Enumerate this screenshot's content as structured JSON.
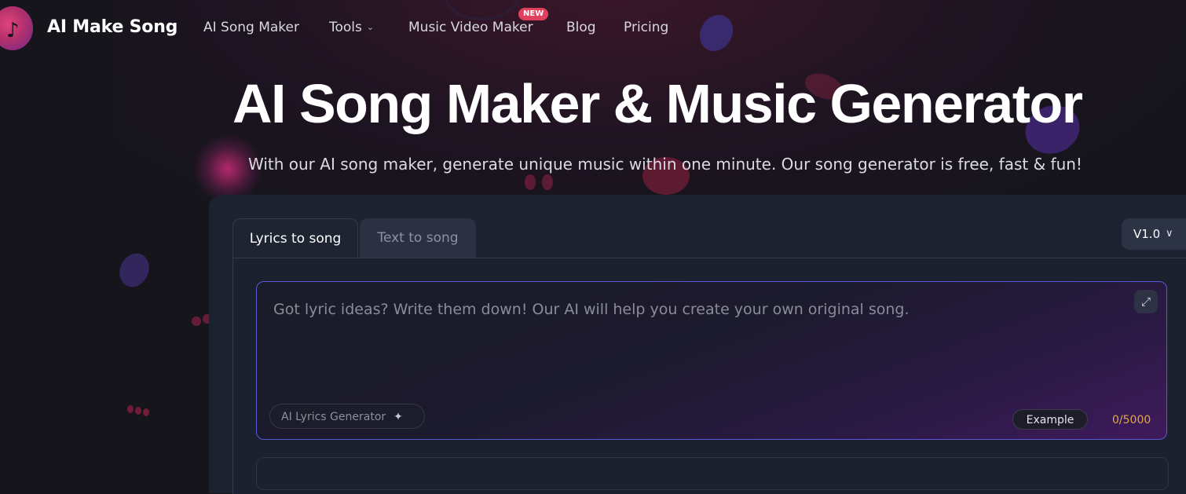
{
  "header": {
    "brand": "AI Make Song",
    "nav": {
      "ai_song_maker": "AI Song Maker",
      "tools": "Tools",
      "music_video_maker": "Music Video Maker",
      "new_badge": "NEW",
      "blog": "Blog",
      "pricing": "Pricing"
    }
  },
  "hero": {
    "title": "AI Song Maker & Music Generator",
    "subtitle": "With our AI song maker, generate unique music within one minute. Our song generator is free, fast & fun!"
  },
  "generator": {
    "tabs": [
      "Lyrics to song",
      "Text to song"
    ],
    "active_tab": "Lyrics to song",
    "version": "V1.0",
    "lyrics_placeholder": "Got lyric ideas? Write them down! Our AI will help you create your own original song.",
    "lyrics_value": "",
    "ai_lyrics_button": "AI Lyrics Generator",
    "example_button": "Example",
    "char_counter": "0/5000"
  },
  "colors": {
    "background": "#16151c",
    "panel": "#1d2230",
    "accent_border": "#5b58d8",
    "badge": "#e0405e",
    "counter": "#e0a84a"
  },
  "icons": {
    "logo": "music-note-icon",
    "tools_dropdown": "chevron-down-icon",
    "version_dropdown": "chevron-down-icon",
    "expand": "expand-icon",
    "sparkle": "sparkle-icon"
  }
}
